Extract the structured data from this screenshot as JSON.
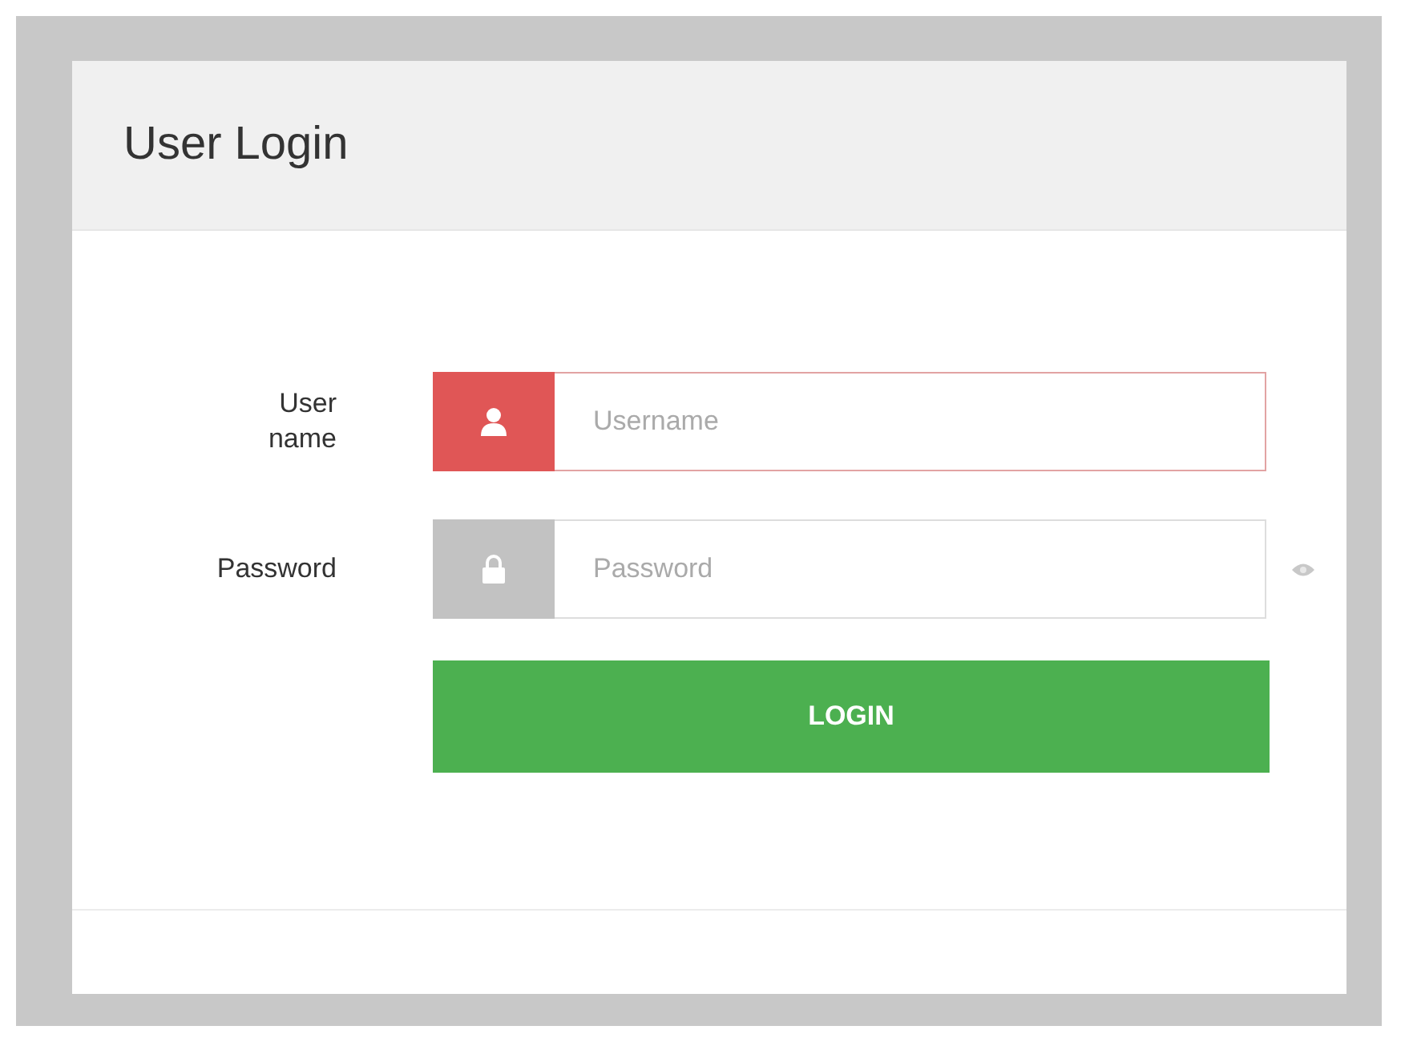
{
  "panel": {
    "title": "User Login"
  },
  "fields": [
    {
      "label": "User name",
      "placeholder": "Username",
      "kind": "user",
      "invalid": true,
      "reveal_toggle": false
    },
    {
      "label": "Password",
      "placeholder": "Password",
      "kind": "password",
      "invalid": false,
      "reveal_toggle": true
    }
  ],
  "button": "LOGIN"
}
